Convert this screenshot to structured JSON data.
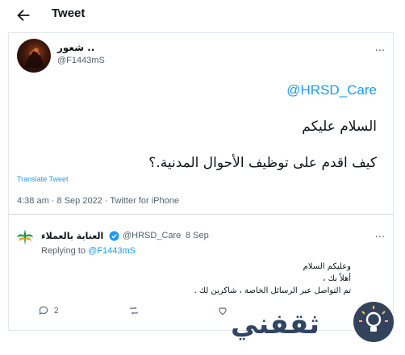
{
  "header": {
    "title": "Tweet",
    "back_icon": "arrow-left-icon"
  },
  "tweet": {
    "display_name": "شعور ..",
    "handle": "@F1443mS",
    "mention": "@HRSD_Care",
    "line1": "السلام عليكم",
    "line2": "كيف اقدم على توظيف الأحوال المدنية.؟",
    "translate": "Translate Tweet",
    "meta": "4:38 am · 8 Sep 2022 · Twitter for iPhone",
    "more": "···"
  },
  "reply": {
    "display_name": "العناية بالعملاء",
    "handle": "@HRSD_Care",
    "dot": "·",
    "date": "8 Sep",
    "more": "···",
    "replying_to_prefix": "Replying to ",
    "replying_to_user": "@F1443mS",
    "body": [
      "وعليكم السلام",
      "أهلاً بك ،",
      "تم التواصل عبر الرسائل الخاصة ، شاكرين لك ."
    ],
    "actions": {
      "reply_count": "2",
      "retweet_count": "",
      "like_count": ""
    }
  },
  "watermark": {
    "text": "ثقفني"
  },
  "colors": {
    "accent": "#1d9bf0",
    "muted": "#536471",
    "border": "#e1e8ed"
  }
}
